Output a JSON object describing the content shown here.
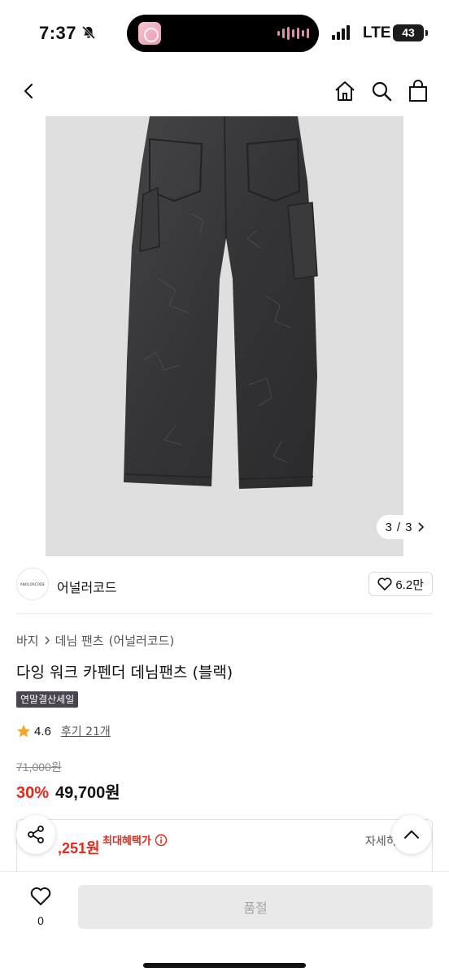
{
  "status_bar": {
    "time": "7:37",
    "network": "LTE",
    "battery": "43"
  },
  "nav": {
    "icons": [
      "chevron-left-icon",
      "home-icon",
      "search-icon",
      "bag-icon"
    ]
  },
  "gallery": {
    "counter_current": "3",
    "counter_sep": "/",
    "counter_total": "3"
  },
  "brand": {
    "logo_text": "ANOLORCODE",
    "name": "어널러코드",
    "like_count": "6.2만"
  },
  "breadcrumb": {
    "items": [
      "바지",
      "데님 팬츠",
      "(어널러코드)"
    ]
  },
  "product": {
    "title": "다잉 워크 카펜더 데님팬츠 (블랙)",
    "badge": "연말결산세일",
    "rating": "4.6",
    "review_text": "후기 21개",
    "original_price": "71,000원",
    "discount": "30%",
    "price": "49,700원"
  },
  "benefit": {
    "price": ",251원",
    "label": "최대혜택가",
    "detail": "자세히"
  },
  "bottom": {
    "wish_count": "0",
    "cta_label": "품절"
  },
  "colors": {
    "accent_red": "#e4291d",
    "badge_bg": "#4a4452",
    "denim": "#3a3a3c"
  }
}
